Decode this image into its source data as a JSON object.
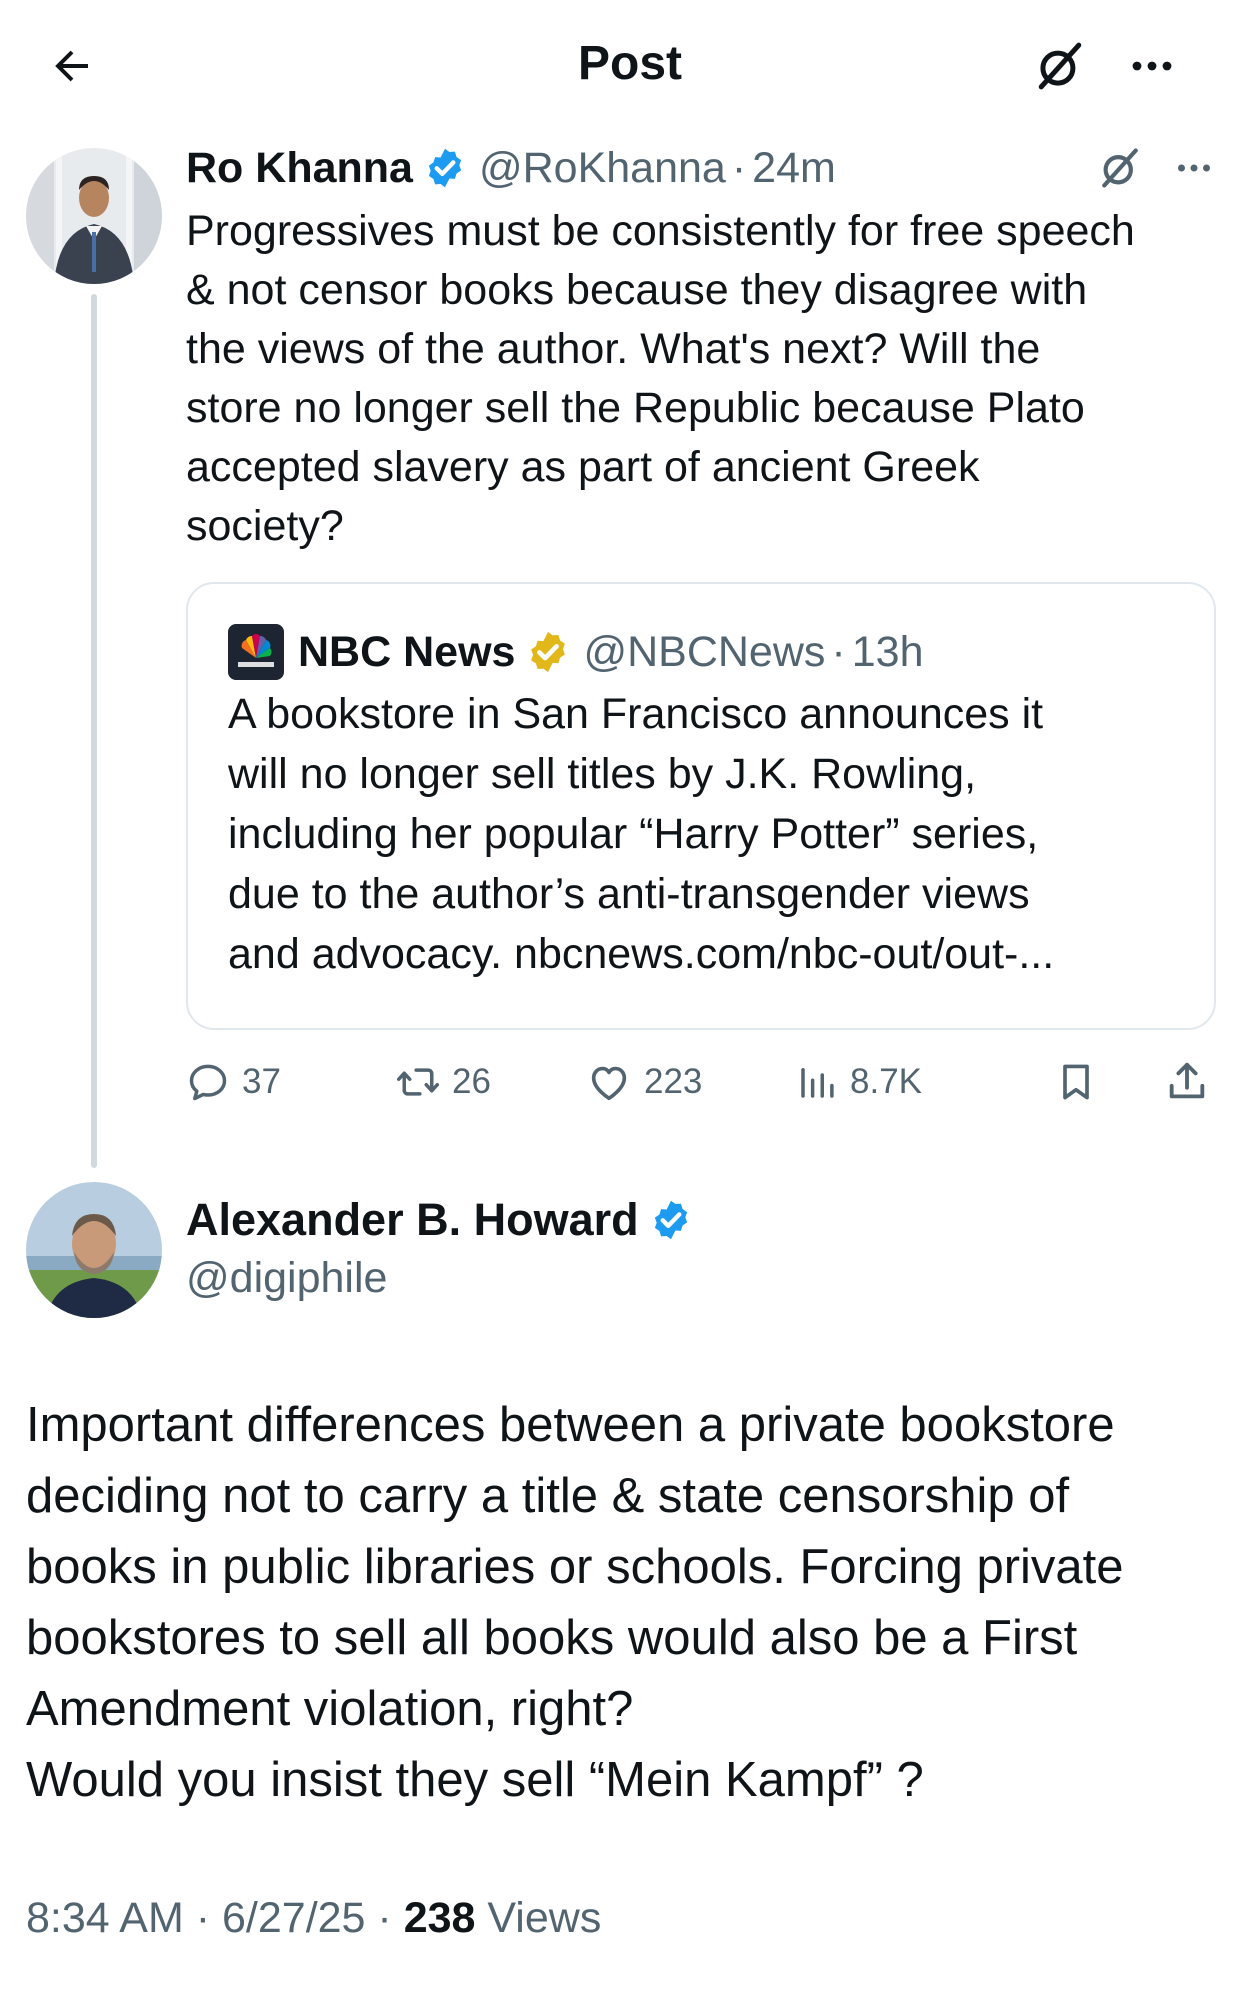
{
  "header": {
    "title": "Post",
    "back_icon": "arrow-left-icon",
    "grok_icon": "grok-icon",
    "more_icon": "more-horizontal-icon"
  },
  "parent_tweet": {
    "name": "Ro Khanna",
    "verified": true,
    "verified_color": "#1d9bf0",
    "handle": "@RoKhanna",
    "separator": "·",
    "time": "24m",
    "text": "Progressives must be consistently for free speech\n& not censor books because they disagree with\nthe views of the author. What's next? Will the\nstore no longer sell the Republic because Plato\naccepted slavery as part of ancient Greek\nsociety?",
    "quote": {
      "name": "NBC News",
      "verified_color": "#e2b719",
      "handle": "@NBCNews",
      "separator": "·",
      "time": "13h",
      "text": "A bookstore in San Francisco announces it\nwill no longer sell titles by J.K. Rowling,\nincluding her popular “Harry Potter” series,\ndue to the author’s anti-transgender views\nand advocacy. nbcnews.com/nbc-out/out-..."
    },
    "actions": {
      "replies": "37",
      "reposts": "26",
      "likes": "223",
      "views": "8.7K"
    }
  },
  "main_tweet": {
    "name": "Alexander B. Howard",
    "verified": true,
    "handle": "@digiphile",
    "text": "Important differences between a private bookstore\ndeciding not to carry a title & state censorship of\nbooks in public libraries or schools. Forcing private\nbookstores to sell all books would also be a First\nAmendment violation, right?\nWould you insist they sell “Mein Kampf” ?",
    "time": "8:34 AM",
    "separator": "·",
    "date": "6/27/25",
    "views_count": "238",
    "views_label": "Views"
  },
  "colors": {
    "text_primary": "#0f1419",
    "text_secondary": "#536471",
    "border": "#e1e8ed",
    "thread_line": "#cfd9de",
    "verified_blue": "#1d9bf0",
    "verified_gold": "#e2b719"
  }
}
